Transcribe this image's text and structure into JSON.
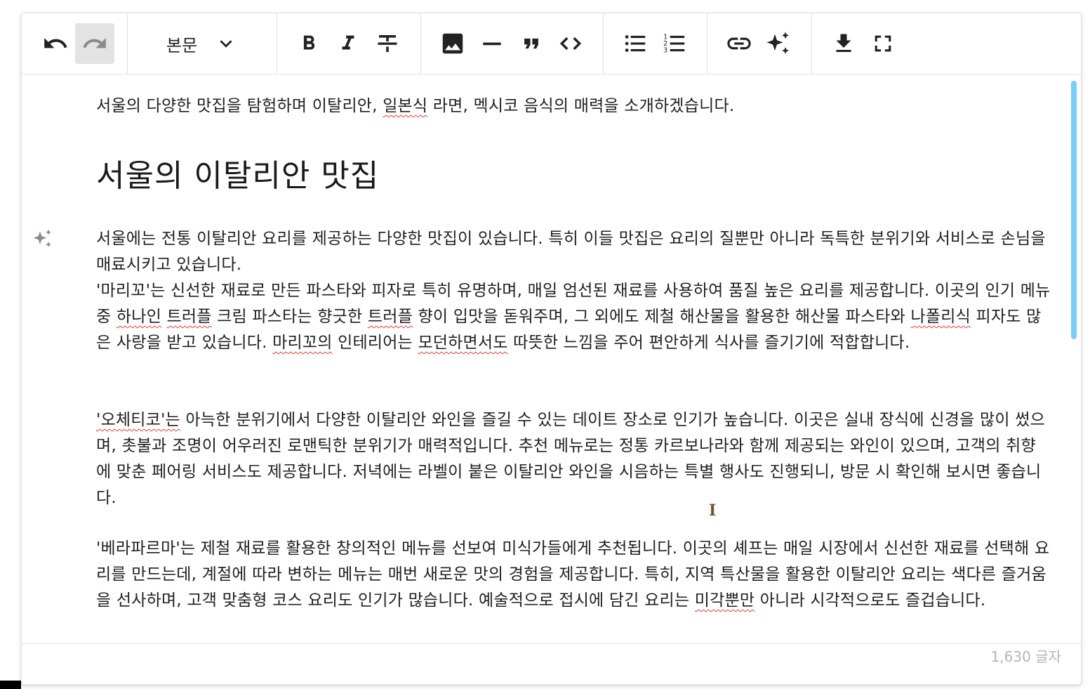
{
  "toolbar": {
    "block_format": "본문",
    "buttons": [
      "undo-icon",
      "redo-icon",
      "bold-icon",
      "italic-icon",
      "strikethrough-icon",
      "image-icon",
      "horizontal-rule-icon",
      "quote-icon",
      "code-icon",
      "bullet-list-icon",
      "numbered-list-icon",
      "link-icon",
      "ai-sparkle-icon",
      "download-icon",
      "fullscreen-icon"
    ]
  },
  "content": {
    "intro_a": "서울의 다양한 맛집을 탐험하며 이탈리안, ",
    "intro_sq": "일본식",
    "intro_b": " 라면, 멕시코 음식의 매력을 소개하겠습니다.",
    "heading": "서울의 이탈리안 맛집",
    "p1": "서울에는 전통 이탈리안 요리를 제공하는 다양한 맛집이 있습니다. 특히 이들 맛집은 요리의 질뿐만 아니라 독특한 분위기와 서비스로 손님을 매료시키고 있습니다.",
    "p2": {
      "a": "'마리꼬'는 신선한 재료로 만든 파스타와 피자로 특히 유명하며, 매일 엄선된 재료를 사용하여 품질 높은 요리를 제공합니다. 이곳의 인기 메뉴 중 ",
      "s1": "하나인",
      "b": " ",
      "s2": "트러플",
      "c": " 크림 파스타는 향긋한 ",
      "s3": "트러플",
      "d": " 향이 입맛을 돋워주며, 그 외에도 제철 해산물을 활용한 해산물 파스타와 ",
      "s4": "나폴리식",
      "e": " 피자도 많은 사랑을 받고 있습니다. ",
      "s5": "마리꼬의",
      "f": " 인테리어는 ",
      "s6": "모던하면서도",
      "g": " 따뜻한 느낌을 주어 편안하게 식사를 즐기기에 적합합니다."
    },
    "p3": {
      "s1": "'오체티코'는",
      "a": " 아늑한 분위기에서 다양한 이탈리안 와인을 즐길 수 있는 데이트 장소로 인기가 높습니다. 이곳은 실내 장식에 신경을 많이 썼으며, 촛불과 조명이 어우러진 로맨틱한 분위기가 매력적입니다. 추천 메뉴로는 정통 카르보나라와 함께 제공되는 와인이 있으며, 고객의 취향에 맞춘 페어링 서비스도 제공합니다. 저녁에는 라벨이 붙은 이탈리안 와인을 시음하는 특별 행사도 진행되니, 방문 시 확인해 보시면 좋습니다."
    },
    "p4": {
      "a": "'베라파르마'는 제철 재료를 활용한 창의적인 메뉴를 선보여 미식가들에게 추천됩니다. 이곳의 셰프는 매일 시장에서 신선한 재료를 선택해 요리를 만드는데, 계절에 따라 변하는 메뉴는 매번 새로운 맛의 경험을 제공합니다. 특히, 지역 특산물을 활용한 이탈리안 요리는 색다른 즐거움을 선사하며, 고객 맞춤형 코스 요리도 인기가 많습니다. 예술적으로 접시에 담긴 요리는 ",
      "s1": "미각뿐만",
      "b": " 아니라 시각적으로도 즐겁습니다."
    }
  },
  "footer": {
    "word_count": "1,630 글자"
  },
  "colors": {
    "scroll_thumb": "#78cdfc",
    "spell_error": "#e53935",
    "active_button": "#e3e3e3"
  }
}
